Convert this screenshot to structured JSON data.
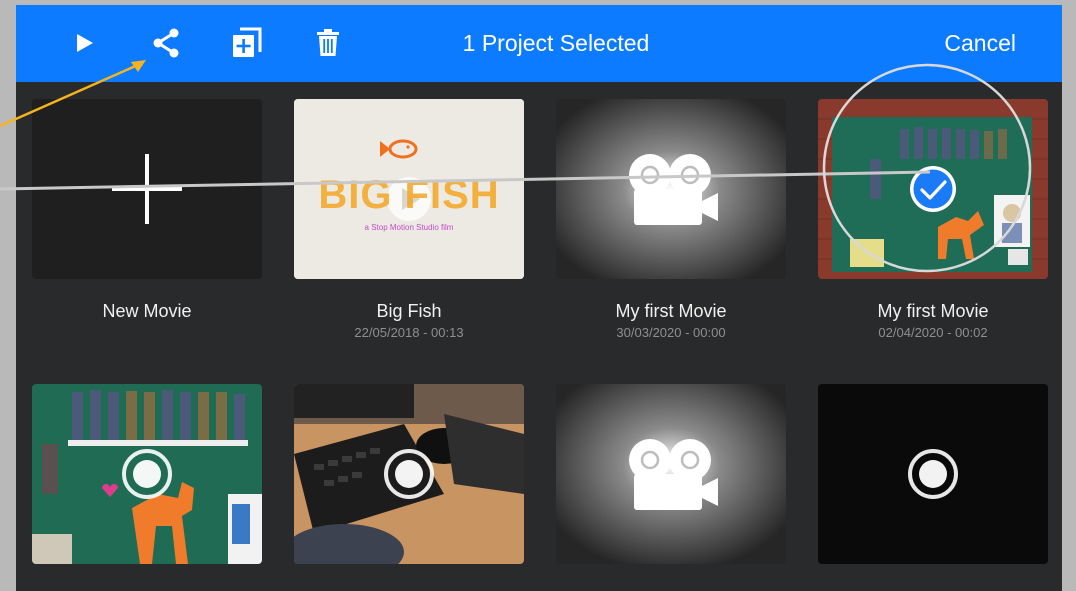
{
  "toolbar": {
    "title": "1 Project Selected",
    "cancel_label": "Cancel",
    "accent_color": "#0d7bff",
    "icons": [
      "play-icon",
      "share-icon",
      "duplicate-icon",
      "trash-icon"
    ]
  },
  "projects": [
    {
      "name": "New Movie",
      "date": "",
      "thumbnail": "plus-icon"
    },
    {
      "name": "Big Fish",
      "date": "22/05/2018 - 00:13",
      "thumbnail": "big-fish-title",
      "thumb_text": "BIG FISH",
      "thumb_subtitle": "a Stop Motion Studio film"
    },
    {
      "name": "My first Movie",
      "date": "30/03/2020 - 00:00",
      "thumbnail": "movie-camera-icon"
    },
    {
      "name": "My first Movie",
      "date": "02/04/2020 - 00:02",
      "thumbnail": "photo-soldiers",
      "selected": true
    },
    {
      "name": "",
      "date": "",
      "thumbnail": "photo-soldiers-dog"
    },
    {
      "name": "",
      "date": "",
      "thumbnail": "photo-desk-keyboard"
    },
    {
      "name": "",
      "date": "",
      "thumbnail": "movie-camera-icon"
    },
    {
      "name": "",
      "date": "",
      "thumbnail": "black-frame"
    }
  ]
}
